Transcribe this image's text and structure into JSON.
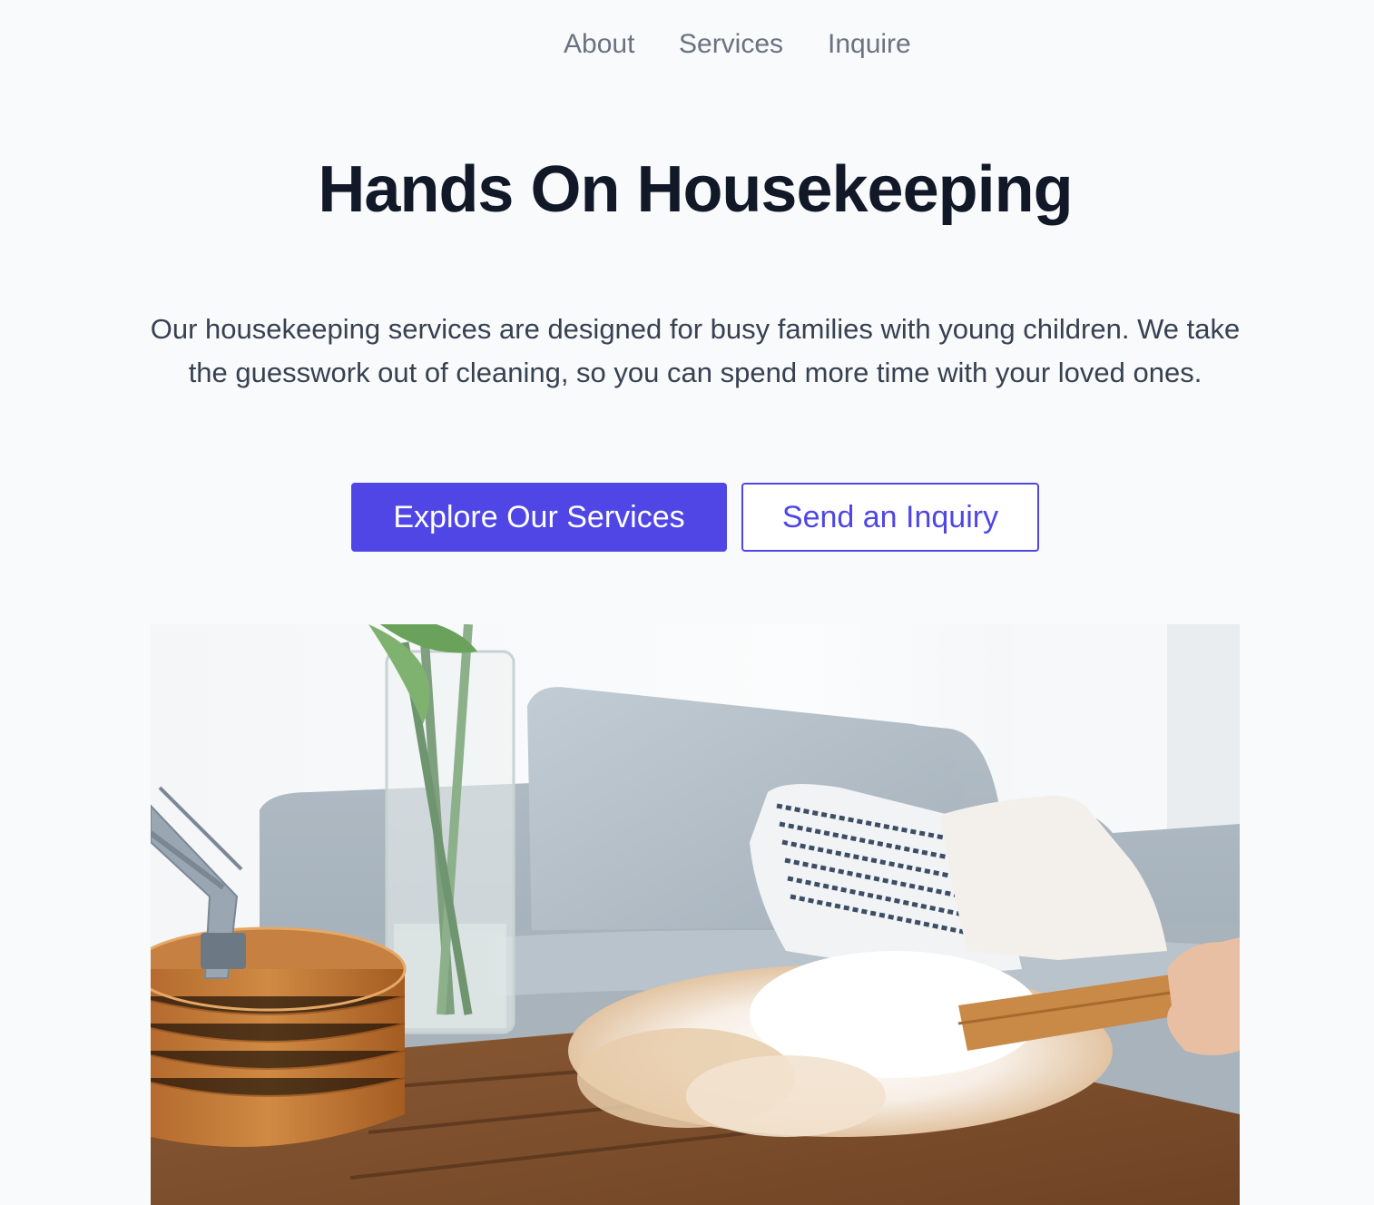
{
  "nav": {
    "items": [
      {
        "label": "About"
      },
      {
        "label": "Services"
      },
      {
        "label": "Inquire"
      }
    ]
  },
  "hero": {
    "title": "Hands On Housekeeping",
    "description": "Our housekeeping services are designed for busy families with young children. We take the guesswork out of cleaning, so you can spend more time with your loved ones.",
    "primary_button": "Explore Our Services",
    "secondary_button": "Send an Inquiry"
  },
  "colors": {
    "background": "#f9fafb",
    "accent": "#4f46e5",
    "heading": "#111827",
    "body_text": "#374151",
    "nav_text": "#6b7280"
  }
}
